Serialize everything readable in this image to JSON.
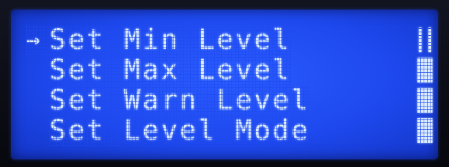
{
  "menu": {
    "cursor_glyph": "→",
    "items": [
      {
        "label": "Set Min Level",
        "selected": true,
        "indicator": "empty"
      },
      {
        "label": "Set Max Level",
        "selected": false,
        "indicator": "full"
      },
      {
        "label": "Set Warn Level",
        "selected": false,
        "indicator": "full"
      },
      {
        "label": "Set Level Mode",
        "selected": false,
        "indicator": "full"
      }
    ]
  },
  "colors": {
    "backlight": "#1e49ef",
    "text": "#dcecff",
    "bezel": "#0a0c14"
  }
}
